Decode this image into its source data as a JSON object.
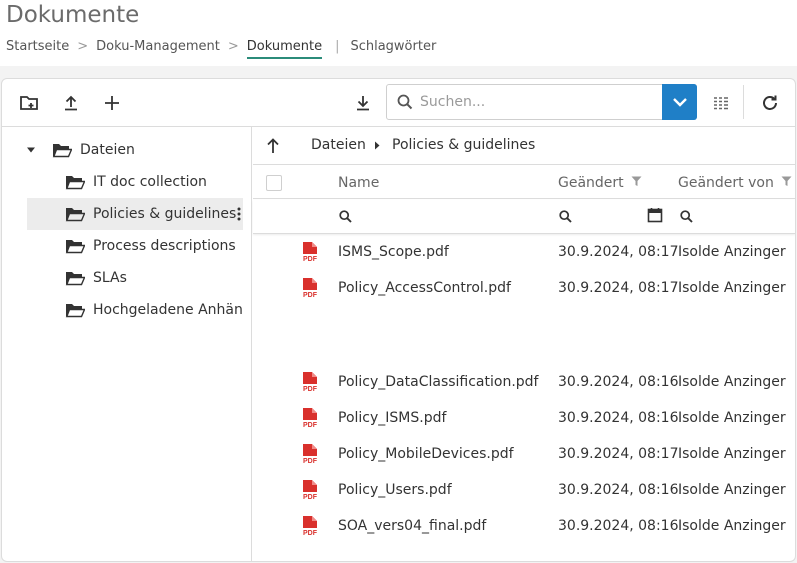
{
  "page": {
    "title": "Dokumente",
    "breadcrumb": [
      "Startseite",
      "Doku-Management",
      "Dokumente"
    ],
    "extra_tab": "Schlagwörter"
  },
  "toolbar": {
    "search_placeholder": "Suchen...",
    "accent_color": "#1f7fc7"
  },
  "tree": {
    "root": "Dateien",
    "children": [
      "IT doc collection",
      "Policies & guidelines",
      "Process descriptions",
      "SLAs",
      "Hochgeladene Anhänge"
    ],
    "selected_index": 1
  },
  "path": [
    "Dateien",
    "Policies & guidelines"
  ],
  "columns": [
    "Name",
    "Geändert",
    "Geändert von"
  ],
  "files": [
    {
      "name": "ISMS_Scope.pdf",
      "modified": "30.9.2024, 08:17",
      "by": "Isolde Anzinger"
    },
    {
      "name": "Policy_AccessControl.pdf",
      "modified": "30.9.2024, 08:17",
      "by": "Isolde Anzinger"
    },
    {
      "name": "Policy_DataClassification.pdf",
      "modified": "30.9.2024, 08:16",
      "by": "Isolde Anzinger"
    },
    {
      "name": "Policy_ISMS.pdf",
      "modified": "30.9.2024, 08:16",
      "by": "Isolde Anzinger"
    },
    {
      "name": "Policy_MobileDevices.pdf",
      "modified": "30.9.2024, 08:17",
      "by": "Isolde Anzinger"
    },
    {
      "name": "Policy_Users.pdf",
      "modified": "30.9.2024, 08:16",
      "by": "Isolde Anzinger"
    },
    {
      "name": "SOA_vers04_final.pdf",
      "modified": "30.9.2024, 08:16",
      "by": "Isolde Anzinger"
    }
  ],
  "icons": {
    "file": "pdf-icon",
    "folder": "folder-open-icon"
  }
}
